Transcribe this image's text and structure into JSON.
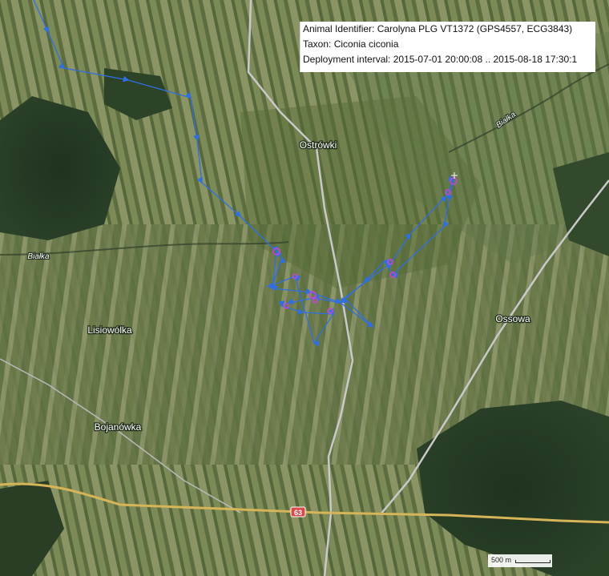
{
  "info_box": {
    "animal_identifier": "Animal Identifier: Carolyna PLG VT1372 (GPS4557, ECG3843)",
    "taxon": "Taxon: Ciconia ciconia",
    "deployment_interval": "Deployment interval: 2015-07-01 20:00:08 .. 2015-08-18 17:30:1"
  },
  "map": {
    "type": "satellite",
    "places": {
      "ostrowki": "Ostrówki",
      "lisiowolka": "Lisiowólka",
      "bojanowka": "Bojanówka",
      "ossowa": "Ossowa"
    },
    "rivers": {
      "bialka_west": "Białka",
      "bialka_east": "Białka"
    },
    "road_shield": "63",
    "scale_label": "500 m",
    "colors": {
      "track": "#2f6fe0",
      "fix": "#c447d8",
      "highway": "#d6b458",
      "road": "#c9c9c9",
      "shield": "#d94b4b"
    },
    "icons": [
      "arrow-icon",
      "start-marker-icon"
    ]
  }
}
